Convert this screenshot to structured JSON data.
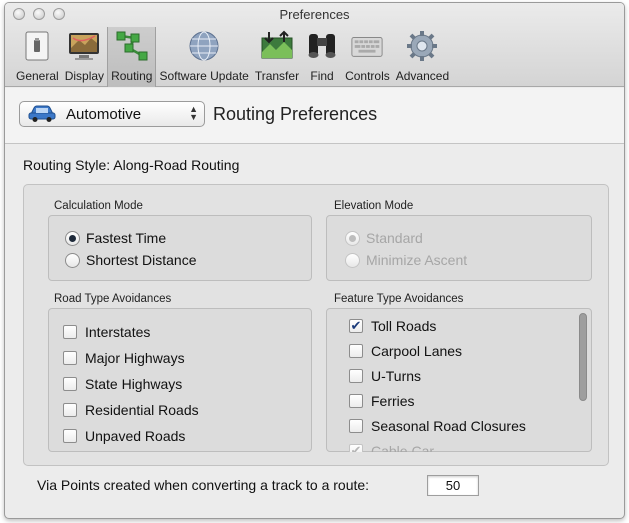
{
  "window": {
    "title": "Preferences"
  },
  "toolbar": {
    "items": [
      {
        "label": "General",
        "icon": "general-switch-icon"
      },
      {
        "label": "Display",
        "icon": "display-monitor-icon"
      },
      {
        "label": "Routing",
        "icon": "routing-nodes-icon",
        "selected": true
      },
      {
        "label": "Software Update",
        "icon": "globe-icon"
      },
      {
        "label": "Transfer",
        "icon": "transfer-icon"
      },
      {
        "label": "Find",
        "icon": "binoculars-icon"
      },
      {
        "label": "Controls",
        "icon": "keyboard-icon"
      },
      {
        "label": "Advanced",
        "icon": "gear-icon"
      }
    ]
  },
  "header": {
    "profile_value": "Automotive",
    "profile_icon": "car-icon",
    "title": "Routing Preferences"
  },
  "routing_style": {
    "text": "Routing Style: Along-Road Routing"
  },
  "calculation_mode": {
    "label": "Calculation Mode",
    "options": [
      {
        "label": "Fastest Time",
        "selected": true
      },
      {
        "label": "Shortest Distance",
        "selected": false
      }
    ]
  },
  "elevation_mode": {
    "label": "Elevation Mode",
    "disabled": true,
    "options": [
      {
        "label": "Standard",
        "selected": true
      },
      {
        "label": "Minimize Ascent",
        "selected": false
      }
    ]
  },
  "road_type_avoidances": {
    "label": "Road Type Avoidances",
    "items": [
      {
        "label": "Interstates",
        "checked": false
      },
      {
        "label": "Major Highways",
        "checked": false
      },
      {
        "label": "State Highways",
        "checked": false
      },
      {
        "label": "Residential Roads",
        "checked": false
      },
      {
        "label": "Unpaved Roads",
        "checked": false
      }
    ]
  },
  "feature_type_avoidances": {
    "label": "Feature Type Avoidances",
    "items": [
      {
        "label": "Toll Roads",
        "checked": true
      },
      {
        "label": "Carpool Lanes",
        "checked": false
      },
      {
        "label": "U-Turns",
        "checked": false
      },
      {
        "label": "Ferries",
        "checked": false
      },
      {
        "label": "Seasonal Road Closures",
        "checked": false
      },
      {
        "label": "Cable Car",
        "checked": true,
        "disabled": true
      }
    ]
  },
  "via_points": {
    "label": "Via Points created when converting a track to a route:",
    "value": "50"
  },
  "colors": {
    "accent": "#1e2a3a",
    "check": "#1a3a7a"
  }
}
